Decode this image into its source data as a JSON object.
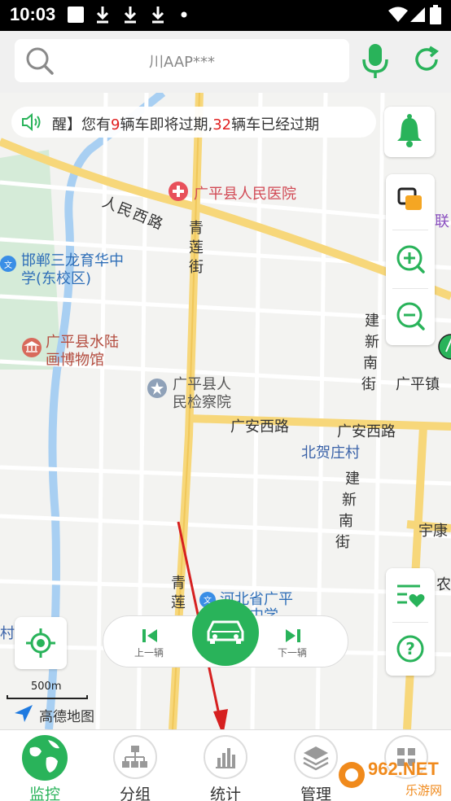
{
  "status_bar": {
    "time": "10:03"
  },
  "search": {
    "text": "川AAP***"
  },
  "notice": {
    "prefix": "醒】您有",
    "count_expiring": "9",
    "middle": "辆车即将过期,",
    "count_expired": "32",
    "suffix": "辆车已经过期"
  },
  "map": {
    "labels": {
      "hospital": "广平县人民医院",
      "renmin_road": "人民西路",
      "qinglian_1": "青",
      "qinglian_2": "莲",
      "qinglian_3": "街",
      "school1_line1": "邯郸三龙育华中",
      "school1_line2": "学(东校区)",
      "museum_line1": "广平县水陆",
      "museum_line2": "画博物馆",
      "procur_line1": "广平县人",
      "procur_line2": "民检察院",
      "guangan_1": "广安西路",
      "guangan_2": "广安西路",
      "beihe": "北贺庄村",
      "jianxin_a1": "建",
      "jianxin_a2": "新",
      "jianxin_a3": "南",
      "jianxin_a4": "街",
      "guangping_town": "广平镇",
      "jianxin_b1": "建",
      "jianxin_b2": "新",
      "jianxin_b3": "南",
      "jianxin_b4": "街",
      "yukang": "宇康",
      "nong": "农",
      "school2_line1": "河北省广平",
      "school2_line2": "实验中学",
      "qinglian_b1": "青",
      "qinglian_b2": "莲",
      "cun": "村",
      "lian": "联"
    },
    "scale": "500m",
    "logo_text": "高德地图"
  },
  "car_control": {
    "prev": "上一辆",
    "next": "下一辆"
  },
  "bottom_nav": [
    {
      "label": "监控",
      "active": true
    },
    {
      "label": "分组",
      "active": false
    },
    {
      "label": "统计",
      "active": false
    },
    {
      "label": "管理",
      "active": false
    }
  ],
  "watermark": {
    "text": "962.NET",
    "sub": "乐游网"
  },
  "colors": {
    "accent": "#29b35a",
    "red": "#e02020",
    "road": "#f7d77a"
  }
}
